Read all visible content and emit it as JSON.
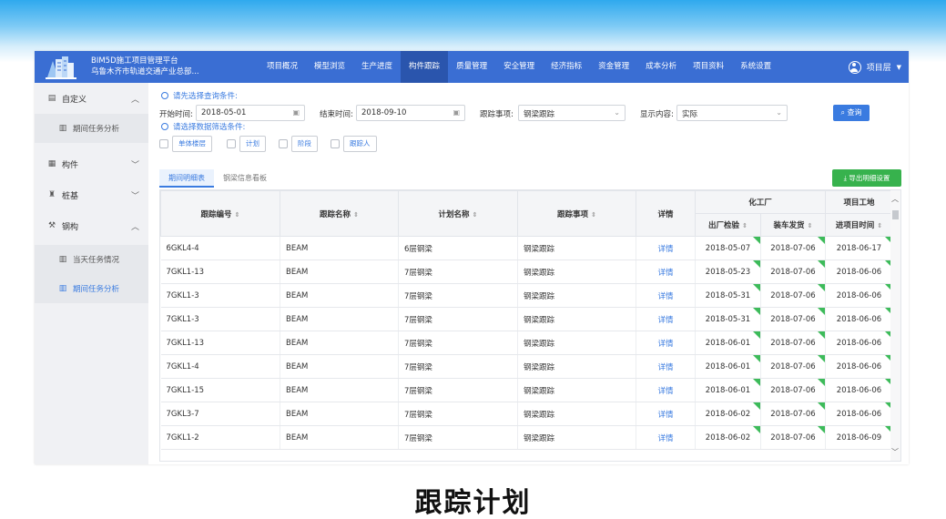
{
  "header": {
    "brand_line1": "BIM5D施工项目管理平台",
    "brand_line2": "乌鲁木齐市轨道交通产业总部...",
    "nav": [
      "项目概况",
      "模型浏览",
      "生产进度",
      "构件跟踪",
      "质量管理",
      "安全管理",
      "经济指标",
      "资金管理",
      "成本分析",
      "项目资料",
      "系统设置"
    ],
    "active_nav": "构件跟踪",
    "user": "项目层"
  },
  "sidebar": {
    "custom": "自定义",
    "custom_sub": "期间任务分析",
    "component": "构件",
    "pile": "桩基",
    "steel": "钢构",
    "steel_sub1": "当天任务情况",
    "steel_sub2": "期间任务分析"
  },
  "query": {
    "hint1": "请先选择查询条件:",
    "start_label": "开始时间:",
    "start_value": "2018-05-01",
    "end_label": "结束时间:",
    "end_value": "2018-09-10",
    "track_label": "跟踪事项:",
    "track_value": "钢梁跟踪",
    "display_label": "显示内容:",
    "display_value": "实际",
    "query_button": "查询",
    "hint2": "请选择数据筛选条件:",
    "filters": [
      "单体楼层",
      "计划",
      "阶段",
      "跟踪人"
    ]
  },
  "tabs": [
    "期间明细表",
    "钢梁信息看板"
  ],
  "export_button": "导出明细设置",
  "table": {
    "headers": {
      "code": "跟踪编号",
      "name": "跟踪名称",
      "plan": "计划名称",
      "item": "跟踪事项",
      "detail": "详情",
      "group1": "化工厂",
      "group2": "项目工地",
      "col_check": "出厂检验",
      "col_ship": "装车发货",
      "col_arrive": "进项目时间"
    },
    "rows": [
      {
        "code": "6GKL4-4",
        "name": "BEAM",
        "plan": "6层钢梁",
        "item": "钢梁跟踪",
        "detail": "详情",
        "check": "2018-05-07",
        "ship": "2018-07-06",
        "arrive": "2018-06-17"
      },
      {
        "code": "7GKL1-13",
        "name": "BEAM",
        "plan": "7层钢梁",
        "item": "钢梁跟踪",
        "detail": "详情",
        "check": "2018-05-23",
        "ship": "2018-07-06",
        "arrive": "2018-06-06"
      },
      {
        "code": "7GKL1-3",
        "name": "BEAM",
        "plan": "7层钢梁",
        "item": "钢梁跟踪",
        "detail": "详情",
        "check": "2018-05-31",
        "ship": "2018-07-06",
        "arrive": "2018-06-06"
      },
      {
        "code": "7GKL1-3",
        "name": "BEAM",
        "plan": "7层钢梁",
        "item": "钢梁跟踪",
        "detail": "详情",
        "check": "2018-05-31",
        "ship": "2018-07-06",
        "arrive": "2018-06-06"
      },
      {
        "code": "7GKL1-13",
        "name": "BEAM",
        "plan": "7层钢梁",
        "item": "钢梁跟踪",
        "detail": "详情",
        "check": "2018-06-01",
        "ship": "2018-07-06",
        "arrive": "2018-06-06"
      },
      {
        "code": "7GKL1-4",
        "name": "BEAM",
        "plan": "7层钢梁",
        "item": "钢梁跟踪",
        "detail": "详情",
        "check": "2018-06-01",
        "ship": "2018-07-06",
        "arrive": "2018-06-06"
      },
      {
        "code": "7GKL1-15",
        "name": "BEAM",
        "plan": "7层钢梁",
        "item": "钢梁跟踪",
        "detail": "详情",
        "check": "2018-06-01",
        "ship": "2018-07-06",
        "arrive": "2018-06-06"
      },
      {
        "code": "7GKL3-7",
        "name": "BEAM",
        "plan": "7层钢梁",
        "item": "钢梁跟踪",
        "detail": "详情",
        "check": "2018-06-02",
        "ship": "2018-07-06",
        "arrive": "2018-06-06"
      },
      {
        "code": "7GKL1-2",
        "name": "BEAM",
        "plan": "7层钢梁",
        "item": "钢梁跟踪",
        "detail": "详情",
        "check": "2018-06-02",
        "ship": "2018-07-06",
        "arrive": "2018-06-09"
      }
    ]
  },
  "caption": "跟踪计划"
}
